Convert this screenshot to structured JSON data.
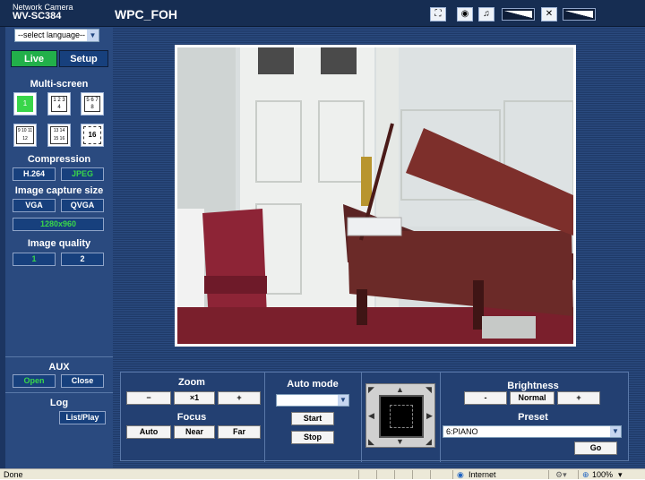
{
  "header": {
    "brand_line1": "Network Camera",
    "brand_model": "WV-SC384",
    "camera_title": "WPC_FOH"
  },
  "sidebar": {
    "language_select": "--select language--",
    "tabs": {
      "live": "Live",
      "setup": "Setup"
    },
    "multiscreen": {
      "heading": "Multi-screen",
      "btn1": "1",
      "btn_1to4": "1 2 3 4",
      "btn_5to8": "5 6 7 8",
      "btn_9to12": "9 10 11 12",
      "btn_13to16": "13 14 15 16",
      "btn_16": "16"
    },
    "compression": {
      "heading": "Compression",
      "h264": "H.264",
      "jpeg": "JPEG"
    },
    "capture": {
      "heading": "Image capture size",
      "vga": "VGA",
      "qvga": "QVGA",
      "hd": "1280x960"
    },
    "quality": {
      "heading": "Image quality",
      "q1": "1",
      "q2": "2"
    },
    "aux": {
      "heading": "AUX",
      "open": "Open",
      "close": "Close"
    },
    "log": {
      "heading": "Log",
      "listplay": "List/Play"
    }
  },
  "controls": {
    "zoom": {
      "heading": "Zoom",
      "zoom_out": "−",
      "x1": "×1",
      "zoom_in": "+"
    },
    "focus": {
      "heading": "Focus",
      "auto": "Auto",
      "near": "Near",
      "far": "Far"
    },
    "automode": {
      "heading": "Auto mode",
      "selected": "",
      "start": "Start",
      "stop": "Stop"
    },
    "brightness": {
      "heading": "Brightness",
      "minus": "-",
      "normal": "Normal",
      "plus": "+"
    },
    "preset": {
      "heading": "Preset",
      "selected": "6:PIANO",
      "go": "Go"
    }
  },
  "statusbar": {
    "left": "Done",
    "zone": "Internet",
    "zoom": "100%"
  },
  "colors": {
    "background": "#1c3561",
    "sidebar": "#2a4a7f",
    "active_green": "#22b04a",
    "button_blue": "#17407d"
  }
}
